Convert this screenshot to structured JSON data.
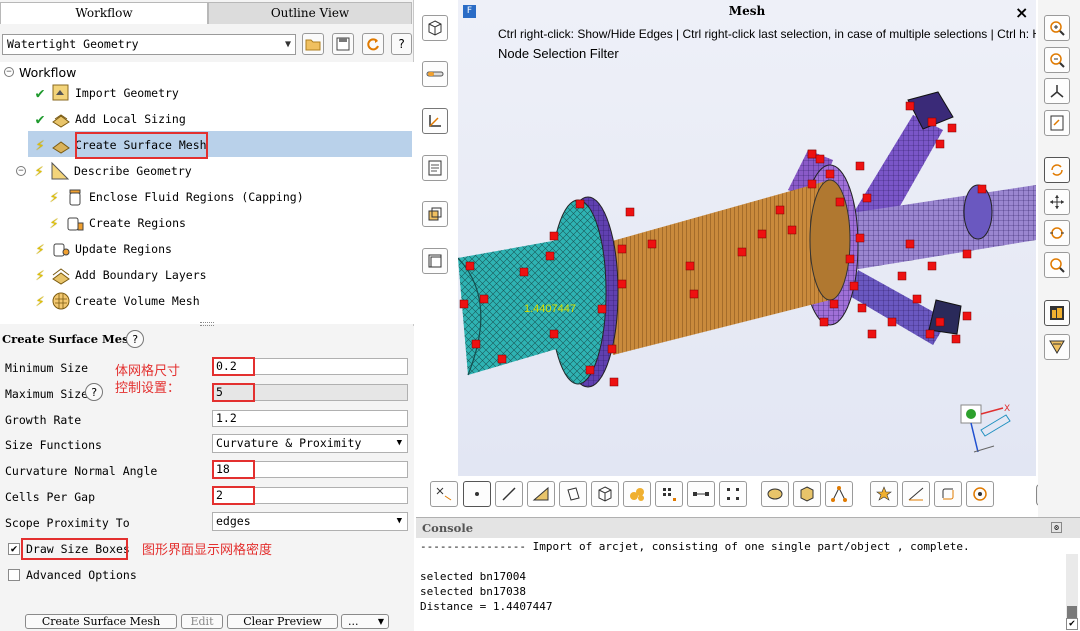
{
  "left": {
    "tabs": {
      "workflow": "Workflow",
      "outline": "Outline View"
    },
    "workflow_type": "Watertight Geometry",
    "tree": {
      "root": "Workflow",
      "items": [
        {
          "label": "Import Geometry",
          "status": "done"
        },
        {
          "label": "Add Local Sizing",
          "status": "done"
        },
        {
          "label": "Create Surface Mesh",
          "status": "pending"
        },
        {
          "label": "Describe Geometry",
          "status": "pending"
        },
        {
          "label": "Enclose Fluid Regions (Capping)",
          "status": "pending"
        },
        {
          "label": "Create Regions",
          "status": "pending"
        },
        {
          "label": "Update Regions",
          "status": "pending"
        },
        {
          "label": "Add Boundary Layers",
          "status": "pending"
        },
        {
          "label": "Create Volume Mesh",
          "status": "pending"
        }
      ]
    },
    "props": {
      "title": "Create Surface Mesh",
      "min_size": {
        "label": "Minimum Size",
        "value": "0.2"
      },
      "max_size": {
        "label": "Maximum Size",
        "value": "5"
      },
      "growth_rate": {
        "label": "Growth Rate",
        "value": "1.2"
      },
      "size_functions": {
        "label": "Size Functions",
        "value": "Curvature & Proximity"
      },
      "curv_angle": {
        "label": "Curvature Normal Angle",
        "value": "18"
      },
      "cells_per_gap": {
        "label": "Cells Per Gap",
        "value": "2"
      },
      "scope": {
        "label": "Scope Proximity To",
        "value": "edges"
      },
      "draw_boxes": {
        "label": "Draw Size Boxes",
        "checked": true
      },
      "advanced": {
        "label": "Advanced Options",
        "checked": false
      }
    },
    "notes": {
      "sizing_line1": "体网格尺寸",
      "sizing_line2": "控制设置：",
      "display": "图形界面显示网格密度"
    },
    "buttons": {
      "create": "Create Surface Mesh",
      "edit": "Edit",
      "clear": "Clear Preview",
      "more": "..."
    }
  },
  "mesh": {
    "title": "Mesh",
    "close": "×",
    "hint": "Ctrl right-click: Show/Hide Edges | Ctrl right-click last selection, in case of multiple selections | Ctrl h: Hotkeys",
    "filter": "Node Selection Filter",
    "distance_label": "1.4407447"
  },
  "console": {
    "title": "Console",
    "lines": [
      "---------------- Import of arcjet, consisting of one single part/object , complete.",
      "",
      "selected bn17004",
      "selected bn17038",
      "Distance = 1.4407447"
    ]
  },
  "colors": {
    "accent_red": "#e3302f",
    "selection_blue": "#b9d1ea",
    "mesh_orange": "#c98a3c",
    "mesh_teal": "#2eb3b3",
    "mesh_purple": "#7a56c8",
    "marker_red": "#ee1111"
  }
}
